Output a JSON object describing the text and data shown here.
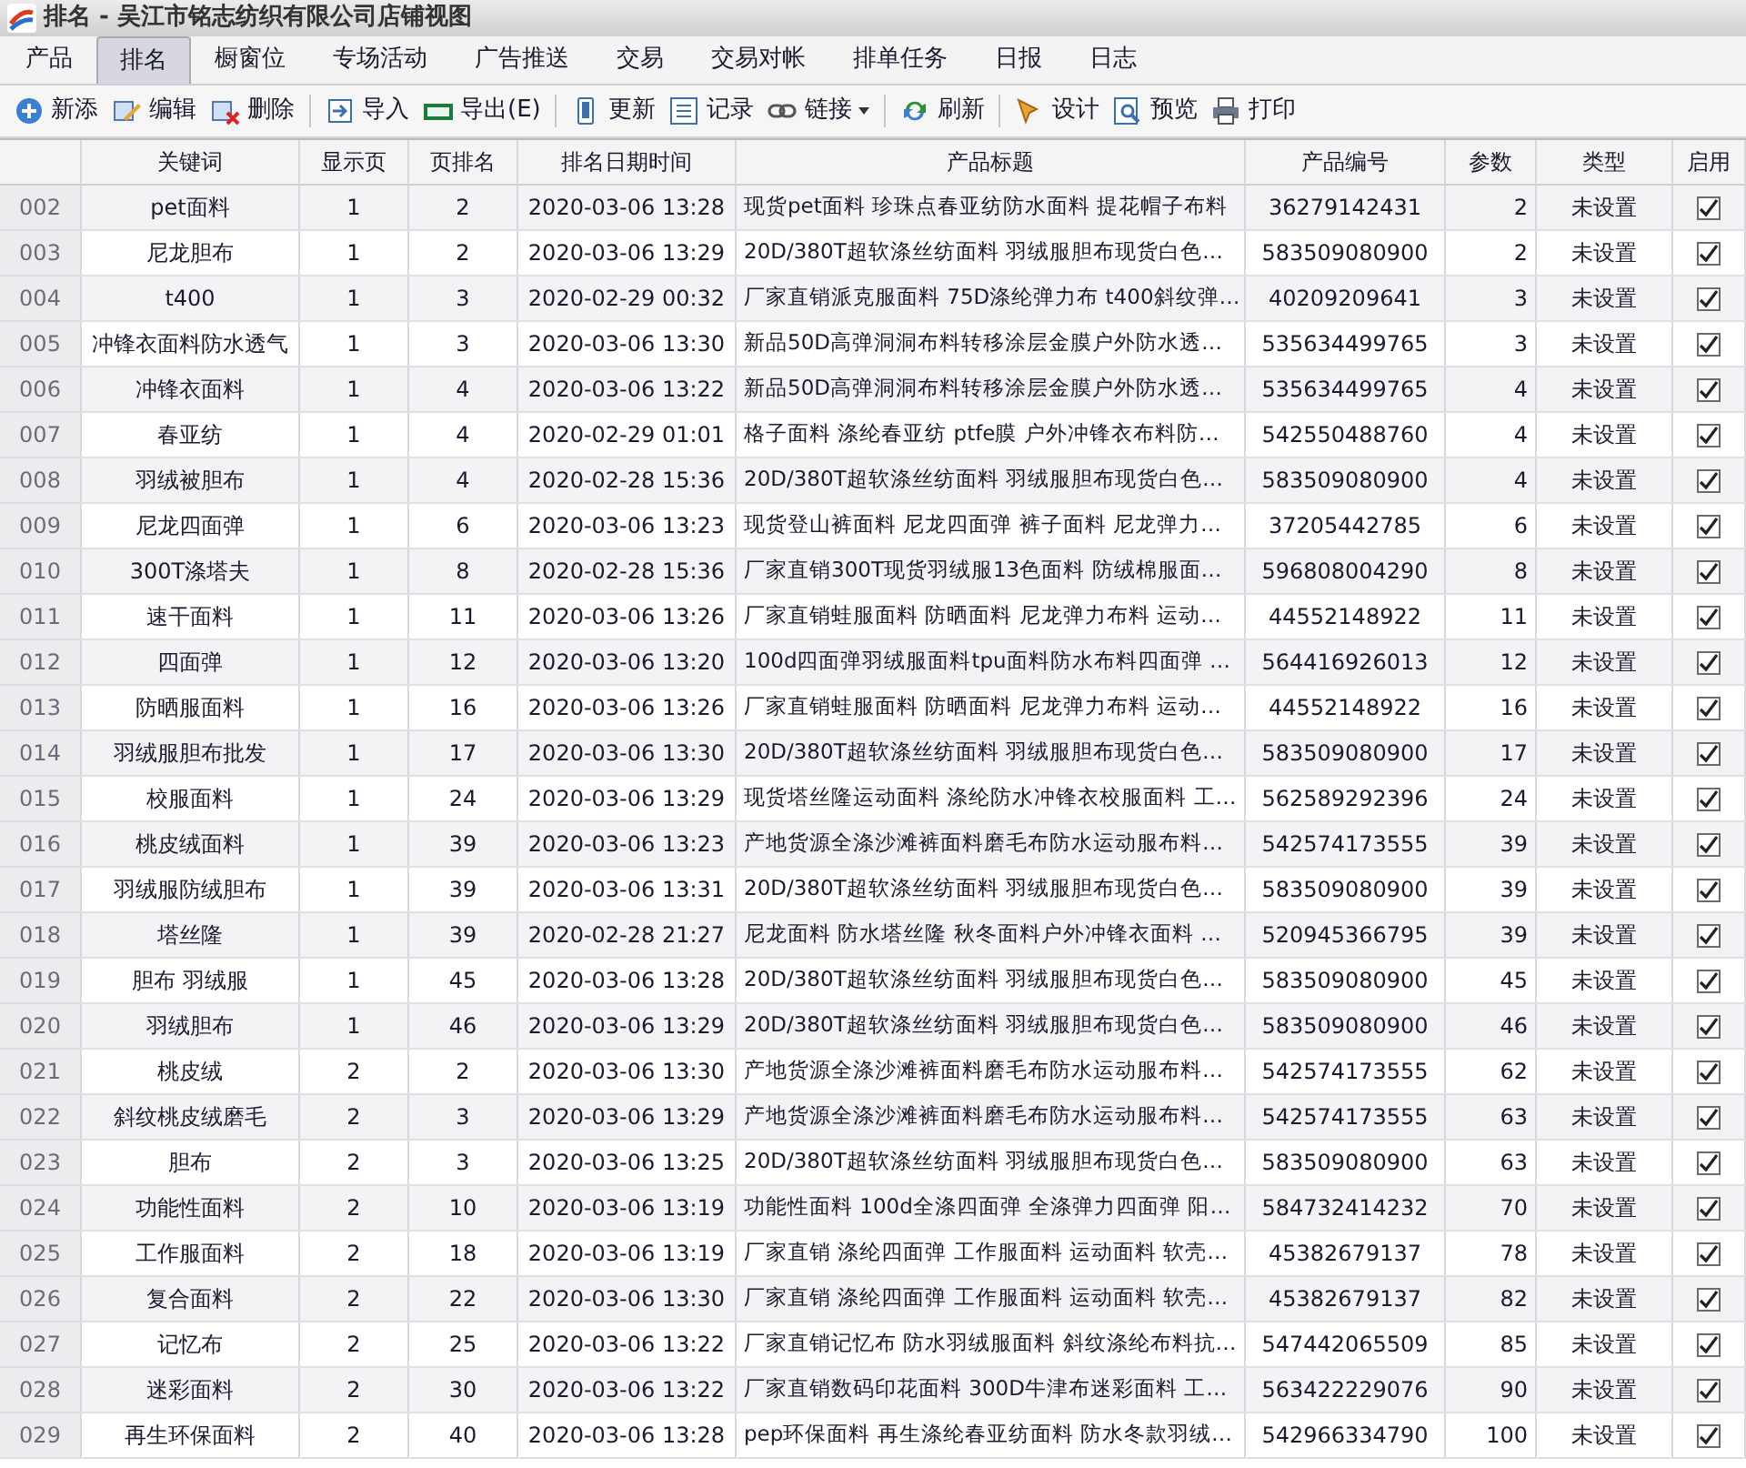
{
  "window": {
    "title": "排名 - 吴江市铭志纺织有限公司店铺视图"
  },
  "tabs": [
    {
      "label": "产品",
      "selected": false
    },
    {
      "label": "排名",
      "selected": true
    },
    {
      "label": "橱窗位",
      "selected": false
    },
    {
      "label": "专场活动",
      "selected": false
    },
    {
      "label": "广告推送",
      "selected": false
    },
    {
      "label": "交易",
      "selected": false
    },
    {
      "label": "交易对帐",
      "selected": false
    },
    {
      "label": "排单任务",
      "selected": false
    },
    {
      "label": "日报",
      "selected": false
    },
    {
      "label": "日志",
      "selected": false
    }
  ],
  "toolbar": {
    "groups": [
      [
        {
          "label": "新添",
          "dropdown": false
        },
        {
          "label": "编辑",
          "dropdown": false
        },
        {
          "label": "删除",
          "dropdown": false
        }
      ],
      [
        {
          "label": "导入",
          "dropdown": false
        },
        {
          "label": "导出(E)",
          "dropdown": false
        }
      ],
      [
        {
          "label": "更新",
          "dropdown": false
        },
        {
          "label": "记录",
          "dropdown": false
        },
        {
          "label": "链接",
          "dropdown": true
        }
      ],
      [
        {
          "label": "刷新",
          "dropdown": false
        }
      ],
      [
        {
          "label": "设计",
          "dropdown": false
        },
        {
          "label": "预览",
          "dropdown": false
        },
        {
          "label": "打印",
          "dropdown": false
        }
      ]
    ]
  },
  "table": {
    "columns": [
      "关键词",
      "显示页",
      "页排名",
      "排名日期时间",
      "产品标题",
      "产品编号",
      "参数",
      "类型",
      "启用"
    ],
    "rows": [
      {
        "index": "002",
        "keyword": "pet面料",
        "page": "1",
        "rank": "2",
        "datetime": "2020-03-06 13:28",
        "title": "现货pet面料 珍珠点春亚纺防水面料 提花帽子布料",
        "product_id": "36279142431",
        "param": "2",
        "type": "未设置",
        "enabled": true
      },
      {
        "index": "003",
        "keyword": "尼龙胆布",
        "page": "1",
        "rank": "2",
        "datetime": "2020-03-06 13:29",
        "title": "20D/380T超软涤丝纺面料 羽绒服胆布现货白色…",
        "product_id": "583509080900",
        "param": "2",
        "type": "未设置",
        "enabled": true
      },
      {
        "index": "004",
        "keyword": "t400",
        "page": "1",
        "rank": "3",
        "datetime": "2020-02-29 00:32",
        "title": "厂家直销派克服面料 75D涤纶弹力布 t400斜纹弹…",
        "product_id": "40209209641",
        "param": "3",
        "type": "未设置",
        "enabled": true
      },
      {
        "index": "005",
        "keyword": "冲锋衣面料防水透气",
        "page": "1",
        "rank": "3",
        "datetime": "2020-03-06 13:30",
        "title": "新品50D高弹洞洞布料转移涂层金膜户外防水透…",
        "product_id": "535634499765",
        "param": "3",
        "type": "未设置",
        "enabled": true
      },
      {
        "index": "006",
        "keyword": "冲锋衣面料",
        "page": "1",
        "rank": "4",
        "datetime": "2020-03-06 13:22",
        "title": "新品50D高弹洞洞布料转移涂层金膜户外防水透…",
        "product_id": "535634499765",
        "param": "4",
        "type": "未设置",
        "enabled": true
      },
      {
        "index": "007",
        "keyword": "春亚纺",
        "page": "1",
        "rank": "4",
        "datetime": "2020-02-29 01:01",
        "title": "格子面料 涤纶春亚纺 ptfe膜 户外冲锋衣布料防…",
        "product_id": "542550488760",
        "param": "4",
        "type": "未设置",
        "enabled": true
      },
      {
        "index": "008",
        "keyword": "羽绒被胆布",
        "page": "1",
        "rank": "4",
        "datetime": "2020-02-28 15:36",
        "title": "20D/380T超软涤丝纺面料 羽绒服胆布现货白色…",
        "product_id": "583509080900",
        "param": "4",
        "type": "未设置",
        "enabled": true
      },
      {
        "index": "009",
        "keyword": "尼龙四面弹",
        "page": "1",
        "rank": "6",
        "datetime": "2020-03-06 13:23",
        "title": "现货登山裤面料 尼龙四面弹 裤子面料 尼龙弹力…",
        "product_id": "37205442785",
        "param": "6",
        "type": "未设置",
        "enabled": true
      },
      {
        "index": "010",
        "keyword": "300T涤塔夫",
        "page": "1",
        "rank": "8",
        "datetime": "2020-02-28 15:36",
        "title": "厂家直销300T现货羽绒服13色面料 防绒棉服面…",
        "product_id": "596808004290",
        "param": "8",
        "type": "未设置",
        "enabled": true
      },
      {
        "index": "011",
        "keyword": "速干面料",
        "page": "1",
        "rank": "11",
        "datetime": "2020-03-06 13:26",
        "title": "厂家直销蛙服面料 防晒面料 尼龙弹力布料 运动…",
        "product_id": "44552148922",
        "param": "11",
        "type": "未设置",
        "enabled": true
      },
      {
        "index": "012",
        "keyword": "四面弹",
        "page": "1",
        "rank": "12",
        "datetime": "2020-03-06 13:20",
        "title": "100d四面弹羽绒服面料tpu面料防水布料四面弹 …",
        "product_id": "564416926013",
        "param": "12",
        "type": "未设置",
        "enabled": true
      },
      {
        "index": "013",
        "keyword": "防晒服面料",
        "page": "1",
        "rank": "16",
        "datetime": "2020-03-06 13:26",
        "title": "厂家直销蛙服面料 防晒面料 尼龙弹力布料 运动…",
        "product_id": "44552148922",
        "param": "16",
        "type": "未设置",
        "enabled": true
      },
      {
        "index": "014",
        "keyword": "羽绒服胆布批发",
        "page": "1",
        "rank": "17",
        "datetime": "2020-03-06 13:30",
        "title": "20D/380T超软涤丝纺面料 羽绒服胆布现货白色…",
        "product_id": "583509080900",
        "param": "17",
        "type": "未设置",
        "enabled": true
      },
      {
        "index": "015",
        "keyword": "校服面料",
        "page": "1",
        "rank": "24",
        "datetime": "2020-03-06 13:29",
        "title": "现货塔丝隆运动面料 涤纶防水冲锋衣校服面料 工…",
        "product_id": "562589292396",
        "param": "24",
        "type": "未设置",
        "enabled": true
      },
      {
        "index": "016",
        "keyword": "桃皮绒面料",
        "page": "1",
        "rank": "39",
        "datetime": "2020-03-06 13:23",
        "title": "产地货源全涤沙滩裤面料磨毛布防水运动服布料…",
        "product_id": "542574173555",
        "param": "39",
        "type": "未设置",
        "enabled": true
      },
      {
        "index": "017",
        "keyword": "羽绒服防绒胆布",
        "page": "1",
        "rank": "39",
        "datetime": "2020-03-06 13:31",
        "title": "20D/380T超软涤丝纺面料 羽绒服胆布现货白色…",
        "product_id": "583509080900",
        "param": "39",
        "type": "未设置",
        "enabled": true
      },
      {
        "index": "018",
        "keyword": "塔丝隆",
        "page": "1",
        "rank": "39",
        "datetime": "2020-02-28 21:27",
        "title": "尼龙面料 防水塔丝隆 秋冬面料户外冲锋衣面料 …",
        "product_id": "520945366795",
        "param": "39",
        "type": "未设置",
        "enabled": true
      },
      {
        "index": "019",
        "keyword": "胆布 羽绒服",
        "page": "1",
        "rank": "45",
        "datetime": "2020-03-06 13:28",
        "title": "20D/380T超软涤丝纺面料 羽绒服胆布现货白色…",
        "product_id": "583509080900",
        "param": "45",
        "type": "未设置",
        "enabled": true
      },
      {
        "index": "020",
        "keyword": "羽绒胆布",
        "page": "1",
        "rank": "46",
        "datetime": "2020-03-06 13:29",
        "title": "20D/380T超软涤丝纺面料 羽绒服胆布现货白色…",
        "product_id": "583509080900",
        "param": "46",
        "type": "未设置",
        "enabled": true
      },
      {
        "index": "021",
        "keyword": "桃皮绒",
        "page": "2",
        "rank": "2",
        "datetime": "2020-03-06 13:30",
        "title": "产地货源全涤沙滩裤面料磨毛布防水运动服布料…",
        "product_id": "542574173555",
        "param": "62",
        "type": "未设置",
        "enabled": true
      },
      {
        "index": "022",
        "keyword": "斜纹桃皮绒磨毛",
        "page": "2",
        "rank": "3",
        "datetime": "2020-03-06 13:29",
        "title": "产地货源全涤沙滩裤面料磨毛布防水运动服布料…",
        "product_id": "542574173555",
        "param": "63",
        "type": "未设置",
        "enabled": true
      },
      {
        "index": "023",
        "keyword": "胆布",
        "page": "2",
        "rank": "3",
        "datetime": "2020-03-06 13:25",
        "title": "20D/380T超软涤丝纺面料 羽绒服胆布现货白色…",
        "product_id": "583509080900",
        "param": "63",
        "type": "未设置",
        "enabled": true
      },
      {
        "index": "024",
        "keyword": "功能性面料",
        "page": "2",
        "rank": "10",
        "datetime": "2020-03-06 13:19",
        "title": "功能性面料 100d全涤四面弹 全涤弹力四面弹  阳…",
        "product_id": "584732414232",
        "param": "70",
        "type": "未设置",
        "enabled": true
      },
      {
        "index": "025",
        "keyword": "工作服面料",
        "page": "2",
        "rank": "18",
        "datetime": "2020-03-06 13:19",
        "title": "厂家直销 涤纶四面弹 工作服面料 运动面料 软壳…",
        "product_id": "45382679137",
        "param": "78",
        "type": "未设置",
        "enabled": true
      },
      {
        "index": "026",
        "keyword": "复合面料",
        "page": "2",
        "rank": "22",
        "datetime": "2020-03-06 13:30",
        "title": "厂家直销 涤纶四面弹 工作服面料 运动面料 软壳…",
        "product_id": "45382679137",
        "param": "82",
        "type": "未设置",
        "enabled": true
      },
      {
        "index": "027",
        "keyword": "记忆布",
        "page": "2",
        "rank": "25",
        "datetime": "2020-03-06 13:22",
        "title": "厂家直销记忆布 防水羽绒服面料 斜纹涤纶布料抗…",
        "product_id": "547442065509",
        "param": "85",
        "type": "未设置",
        "enabled": true
      },
      {
        "index": "028",
        "keyword": "迷彩面料",
        "page": "2",
        "rank": "30",
        "datetime": "2020-03-06 13:22",
        "title": "厂家直销数码印花面料 300D牛津布迷彩面料 工…",
        "product_id": "563422229076",
        "param": "90",
        "type": "未设置",
        "enabled": true
      },
      {
        "index": "029",
        "keyword": "再生环保面料",
        "page": "2",
        "rank": "40",
        "datetime": "2020-03-06 13:28",
        "title": "pep环保面料 再生涤纶春亚纺面料 防水冬款羽绒…",
        "product_id": "542966334790",
        "param": "100",
        "type": "未设置",
        "enabled": true
      }
    ]
  }
}
